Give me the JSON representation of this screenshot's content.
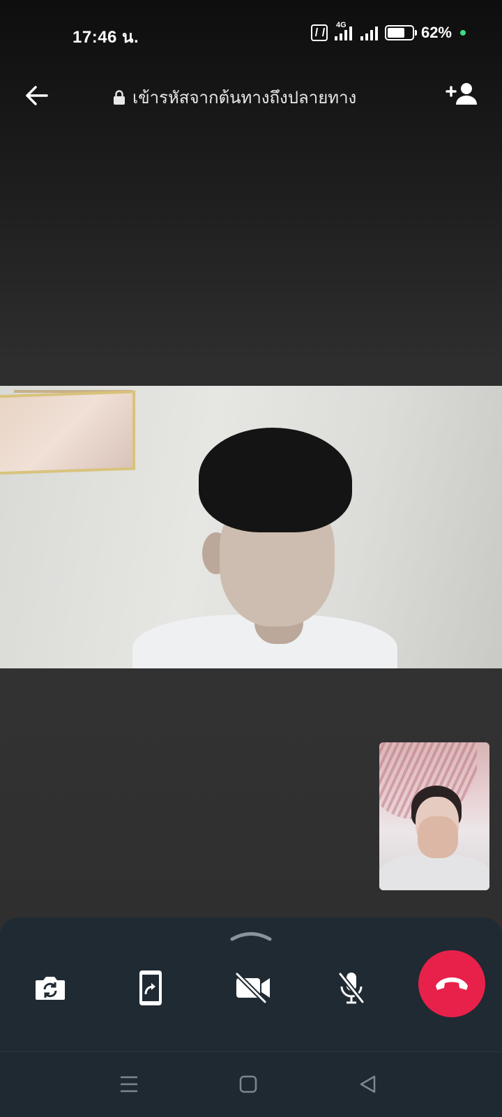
{
  "status_bar": {
    "time": "17:46 น.",
    "network": "4G",
    "battery": "62%",
    "icons": [
      "nfc-icon",
      "signal-icon",
      "battery-icon"
    ]
  },
  "header": {
    "title": "เข้ารหัสจากต้นทางถึงปลายทาง",
    "icons": [
      "back-arrow-icon",
      "lock-icon",
      "add-participant-icon"
    ]
  },
  "controls": {
    "icons": [
      "switch-camera-icon",
      "screen-share-icon",
      "video-off-icon",
      "mic-off-icon",
      "end-call-icon"
    ],
    "colors": {
      "end_call": "#e8214a",
      "tray": "#202a33"
    }
  },
  "nav_bar": {
    "icons": [
      "recents-menu-icon",
      "home-icon",
      "back-triangle-icon"
    ]
  }
}
